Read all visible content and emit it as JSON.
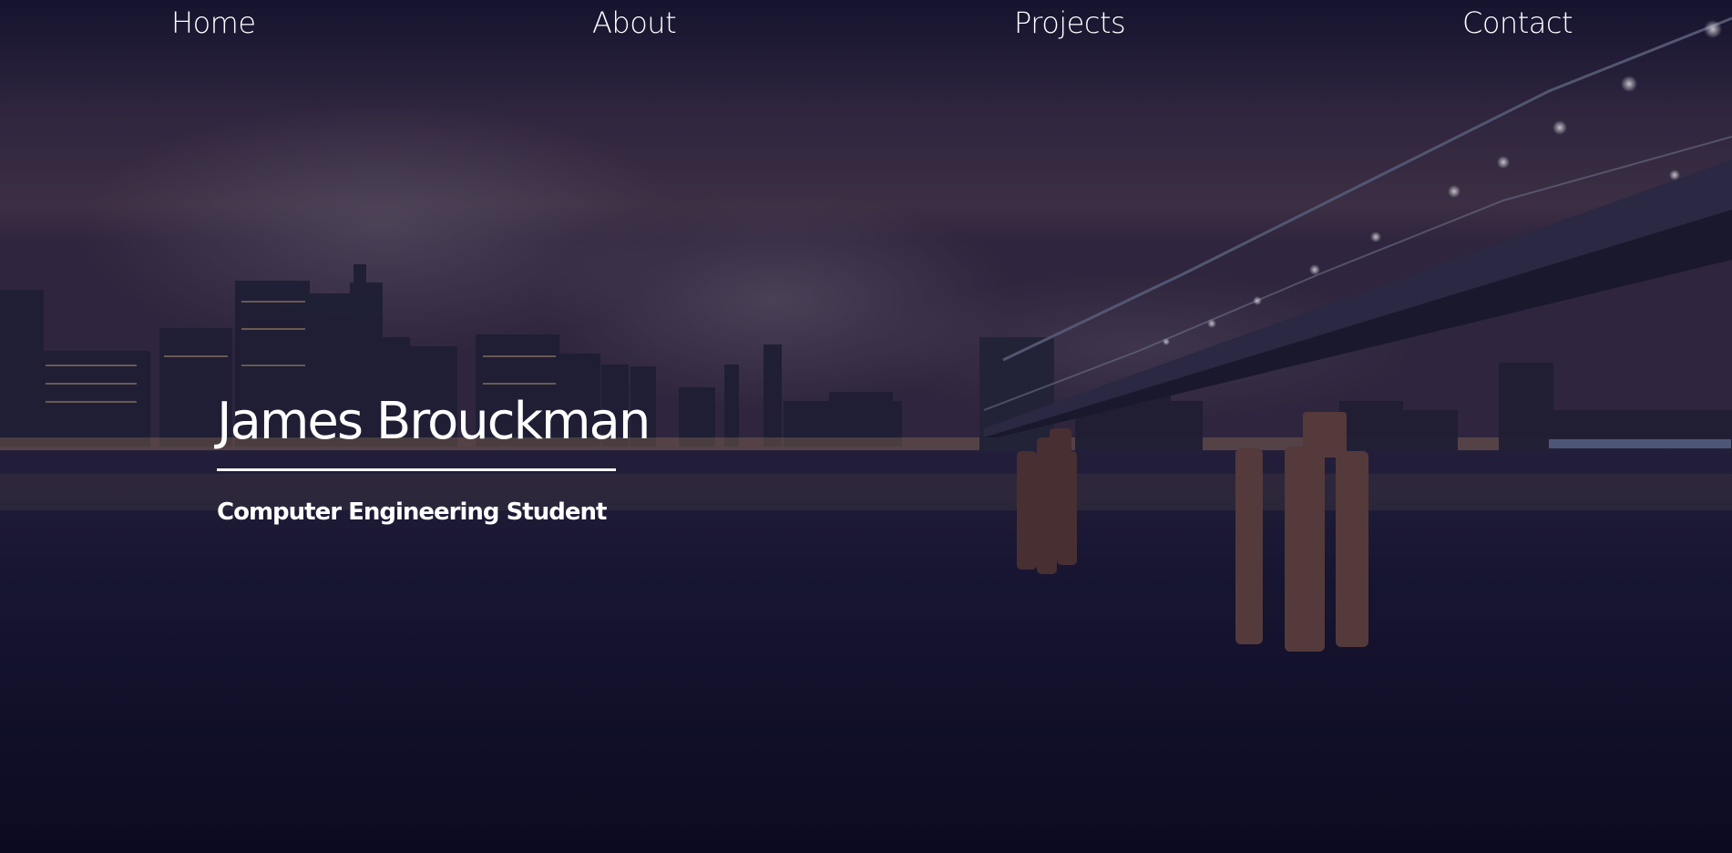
{
  "nav": {
    "items": [
      {
        "label": "Home"
      },
      {
        "label": "About"
      },
      {
        "label": "Projects"
      },
      {
        "label": "Contact"
      }
    ]
  },
  "hero": {
    "name": "James Brouckman",
    "tagline": "Computer Engineering Student",
    "background_description_icon": "city-skyline-bridge-night-image"
  },
  "colors": {
    "text": "#ffffff",
    "overlay": "#1a1535"
  }
}
